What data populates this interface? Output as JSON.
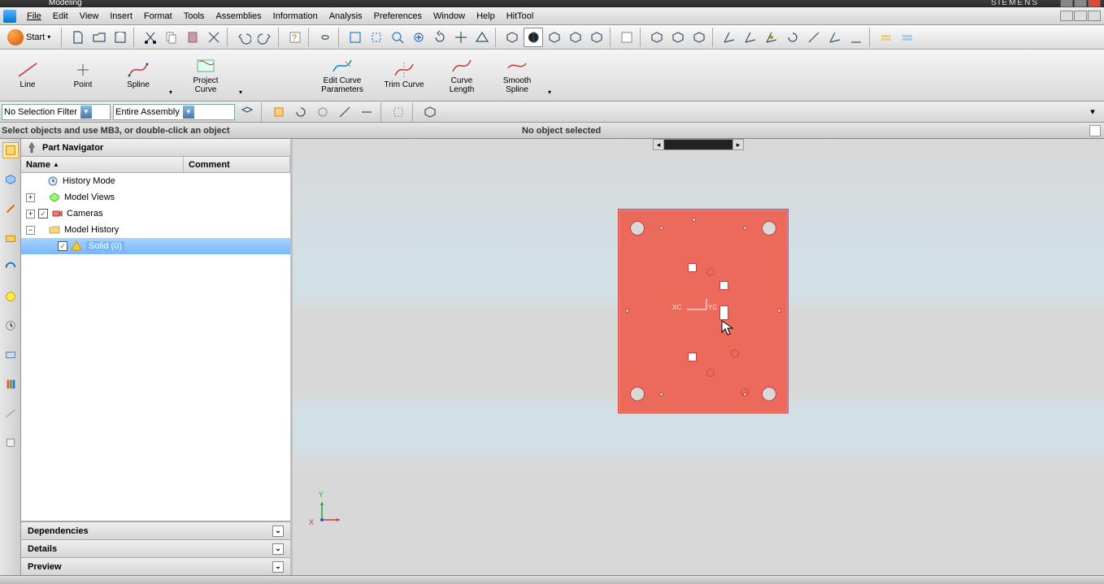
{
  "title": "Modeling",
  "brand": "SIEMENS",
  "menu": [
    "File",
    "Edit",
    "View",
    "Insert",
    "Format",
    "Tools",
    "Assemblies",
    "Information",
    "Analysis",
    "Preferences",
    "Window",
    "Help",
    "HitTool"
  ],
  "start_label": "Start",
  "ribbon": {
    "line": "Line",
    "point": "Point",
    "spline": "Spline",
    "project": "Project\nCurve",
    "editcurve": "Edit Curve\nParameters",
    "trim": "Trim Curve",
    "length": "Curve\nLength",
    "smooth": "Smooth\nSpline"
  },
  "filter": {
    "sel": "No Selection Filter",
    "scope": "Entire Assembly"
  },
  "status": {
    "left": "Select objects and use MB3, or double-click an object",
    "right": "No object selected"
  },
  "navigator": {
    "title": "Part Navigator",
    "cols": [
      "Name",
      "Comment"
    ],
    "history_mode": "History Mode",
    "model_views": "Model Views",
    "cameras": "Cameras",
    "model_history": "Model History",
    "solid": "Solid (0)",
    "sections": [
      "Dependencies",
      "Details",
      "Preview"
    ]
  },
  "triad": {
    "x": "X",
    "y": "Y",
    "xc": "XC",
    "yc": "YC"
  }
}
